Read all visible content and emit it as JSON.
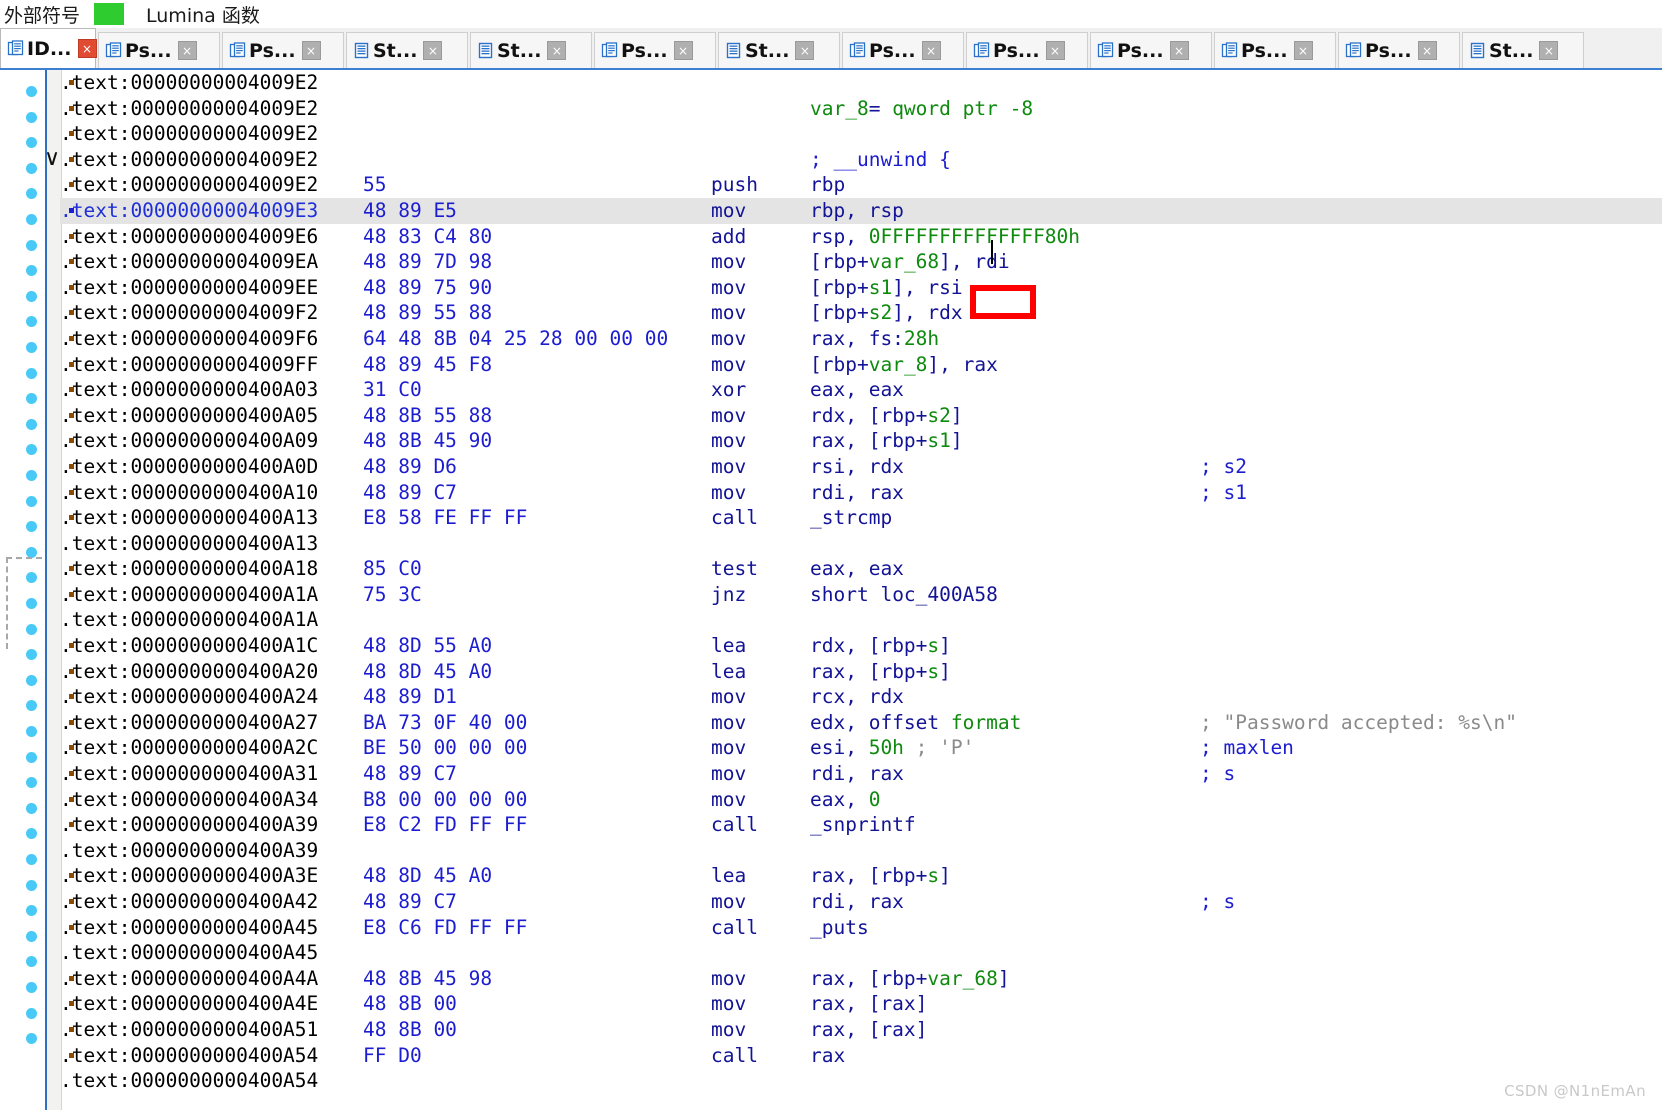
{
  "header": {
    "external_symbols_label": "外部符号",
    "swatch_color": "#2ecc2e",
    "lumina_label": "Lumina 函数"
  },
  "tabs": [
    {
      "label": "ID...",
      "icon": "document-icon",
      "active": true,
      "close": "×"
    },
    {
      "label": "Ps...",
      "icon": "pseudocode-icon",
      "active": false,
      "close": "×"
    },
    {
      "label": "Ps...",
      "icon": "pseudocode-icon",
      "active": false,
      "close": "×"
    },
    {
      "label": "St...",
      "icon": "structures-icon",
      "active": false,
      "close": "×"
    },
    {
      "label": "St...",
      "icon": "structures-icon",
      "active": false,
      "close": "×"
    },
    {
      "label": "Ps...",
      "icon": "pseudocode-icon",
      "active": false,
      "close": "×"
    },
    {
      "label": "St...",
      "icon": "structures-icon",
      "active": false,
      "close": "×"
    },
    {
      "label": "Ps...",
      "icon": "pseudocode-icon",
      "active": false,
      "close": "×"
    },
    {
      "label": "Ps...",
      "icon": "pseudocode-icon",
      "active": false,
      "close": "×"
    },
    {
      "label": "Ps...",
      "icon": "pseudocode-icon",
      "active": false,
      "close": "×"
    },
    {
      "label": "Ps...",
      "icon": "pseudocode-icon",
      "active": false,
      "close": "×"
    },
    {
      "label": "Ps...",
      "icon": "pseudocode-icon",
      "active": false,
      "close": "×"
    },
    {
      "label": "St...",
      "icon": "structures-icon",
      "active": false,
      "close": "×"
    }
  ],
  "colors": {
    "address": "#000000",
    "bytes": "#1d1dd0",
    "mnemonic": "#131396",
    "identifier": "#0e8a0e",
    "comment": "#1d1dd0",
    "string_comment": "#8a8a8a",
    "selection": "#e4e4e4",
    "annotation_box": "#ff0000",
    "gutter_dot": "#49c9f5"
  },
  "annotation": {
    "boxed_operand": "rdi",
    "box_color": "#ff0000"
  },
  "watermark": "CSDN @N1nEmAn",
  "disassembly": {
    "segment": ".text",
    "rows": [
      {
        "addr": ".text:00000000004009E2",
        "bytes": "",
        "mnem": "",
        "ops": [],
        "cmt": "",
        "sel": false,
        "marker": true,
        "chevron": false
      },
      {
        "addr": ".text:00000000004009E2",
        "bytes": "",
        "mnem": "",
        "ops": [
          {
            "t": "name",
            "v": "var_8"
          },
          {
            "t": "op",
            "v": "= "
          },
          {
            "t": "name",
            "v": "qword ptr -8"
          }
        ],
        "cmt": "",
        "sel": false,
        "marker": true,
        "chevron": false
      },
      {
        "addr": ".text:00000000004009E2",
        "bytes": "",
        "mnem": "",
        "ops": [],
        "cmt": "",
        "sel": false,
        "marker": true,
        "chevron": false
      },
      {
        "addr": ".text:00000000004009E2",
        "bytes": "",
        "mnem": "",
        "ops": [
          {
            "t": "cmt",
            "v": "; __unwind {"
          }
        ],
        "cmt": "",
        "sel": false,
        "marker": true,
        "chevron": false
      },
      {
        "addr": ".text:00000000004009E2",
        "bytes": "55",
        "mnem": "push",
        "ops": [
          {
            "t": "op",
            "v": "rbp"
          }
        ],
        "cmt": "",
        "sel": false,
        "marker": true,
        "chevron": true
      },
      {
        "addr": ".text:00000000004009E3",
        "bytes": "48 89 E5",
        "mnem": "mov",
        "ops": [
          {
            "t": "op",
            "v": "rbp, rsp"
          }
        ],
        "cmt": "",
        "sel": true,
        "marker": true,
        "chevron": false
      },
      {
        "addr": ".text:00000000004009E6",
        "bytes": "48 83 C4 80",
        "mnem": "add",
        "ops": [
          {
            "t": "op",
            "v": "rsp, "
          },
          {
            "t": "num",
            "v": "0FFFFFFFFFFFFFF80h"
          }
        ],
        "cmt": "",
        "sel": false,
        "marker": true,
        "chevron": false
      },
      {
        "addr": ".text:00000000004009EA",
        "bytes": "48 89 7D 98",
        "mnem": "mov",
        "ops": [
          {
            "t": "op",
            "v": "["
          },
          {
            "t": "op",
            "v": "rbp+"
          },
          {
            "t": "name",
            "v": "var_68"
          },
          {
            "t": "op",
            "v": "], rdi"
          }
        ],
        "cmt": "",
        "sel": false,
        "marker": true,
        "chevron": false
      },
      {
        "addr": ".text:00000000004009EE",
        "bytes": "48 89 75 90",
        "mnem": "mov",
        "ops": [
          {
            "t": "op",
            "v": "["
          },
          {
            "t": "op",
            "v": "rbp+"
          },
          {
            "t": "name",
            "v": "s1"
          },
          {
            "t": "op",
            "v": "], rsi"
          }
        ],
        "cmt": "",
        "sel": false,
        "marker": true,
        "chevron": false
      },
      {
        "addr": ".text:00000000004009F2",
        "bytes": "48 89 55 88",
        "mnem": "mov",
        "ops": [
          {
            "t": "op",
            "v": "["
          },
          {
            "t": "op",
            "v": "rbp+"
          },
          {
            "t": "name",
            "v": "s2"
          },
          {
            "t": "op",
            "v": "], rdx"
          }
        ],
        "cmt": "",
        "sel": false,
        "marker": true,
        "chevron": false
      },
      {
        "addr": ".text:00000000004009F6",
        "bytes": "64 48 8B 04 25 28 00 00 00",
        "mnem": "mov",
        "ops": [
          {
            "t": "op",
            "v": "rax, fs:"
          },
          {
            "t": "num",
            "v": "28h"
          }
        ],
        "cmt": "",
        "sel": false,
        "marker": true,
        "chevron": false
      },
      {
        "addr": ".text:00000000004009FF",
        "bytes": "48 89 45 F8",
        "mnem": "mov",
        "ops": [
          {
            "t": "op",
            "v": "["
          },
          {
            "t": "op",
            "v": "rbp+"
          },
          {
            "t": "name",
            "v": "var_8"
          },
          {
            "t": "op",
            "v": "], rax"
          }
        ],
        "cmt": "",
        "sel": false,
        "marker": true,
        "chevron": false
      },
      {
        "addr": ".text:0000000000400A03",
        "bytes": "31 C0",
        "mnem": "xor",
        "ops": [
          {
            "t": "op",
            "v": "eax, eax"
          }
        ],
        "cmt": "",
        "sel": false,
        "marker": true,
        "chevron": false
      },
      {
        "addr": ".text:0000000000400A05",
        "bytes": "48 8B 55 88",
        "mnem": "mov",
        "ops": [
          {
            "t": "op",
            "v": "rdx, ["
          },
          {
            "t": "op",
            "v": "rbp+"
          },
          {
            "t": "name",
            "v": "s2"
          },
          {
            "t": "op",
            "v": "]"
          }
        ],
        "cmt": "",
        "sel": false,
        "marker": true,
        "chevron": false
      },
      {
        "addr": ".text:0000000000400A09",
        "bytes": "48 8B 45 90",
        "mnem": "mov",
        "ops": [
          {
            "t": "op",
            "v": "rax, ["
          },
          {
            "t": "op",
            "v": "rbp+"
          },
          {
            "t": "name",
            "v": "s1"
          },
          {
            "t": "op",
            "v": "]"
          }
        ],
        "cmt": "",
        "sel": false,
        "marker": true,
        "chevron": false
      },
      {
        "addr": ".text:0000000000400A0D",
        "bytes": "48 89 D6",
        "mnem": "mov",
        "ops": [
          {
            "t": "op",
            "v": "rsi, rdx"
          }
        ],
        "cmt": "; s2",
        "sel": false,
        "marker": true,
        "chevron": false
      },
      {
        "addr": ".text:0000000000400A10",
        "bytes": "48 89 C7",
        "mnem": "mov",
        "ops": [
          {
            "t": "op",
            "v": "rdi, rax"
          }
        ],
        "cmt": "; s1",
        "sel": false,
        "marker": true,
        "chevron": false
      },
      {
        "addr": ".text:0000000000400A13",
        "bytes": "E8 58 FE FF FF",
        "mnem": "call",
        "ops": [
          {
            "t": "sub",
            "v": "_strcmp"
          }
        ],
        "cmt": "",
        "sel": false,
        "marker": true,
        "chevron": false
      },
      {
        "addr": ".text:0000000000400A13",
        "bytes": "",
        "mnem": "",
        "ops": [],
        "cmt": "",
        "sel": false,
        "marker": false,
        "chevron": false
      },
      {
        "addr": ".text:0000000000400A18",
        "bytes": "85 C0",
        "mnem": "test",
        "ops": [
          {
            "t": "op",
            "v": "eax, eax"
          }
        ],
        "cmt": "",
        "sel": false,
        "marker": true,
        "chevron": false
      },
      {
        "addr": ".text:0000000000400A1A",
        "bytes": "75 3C",
        "mnem": "jnz",
        "ops": [
          {
            "t": "op",
            "v": "short "
          },
          {
            "t": "sub",
            "v": "loc_400A58"
          }
        ],
        "cmt": "",
        "sel": false,
        "marker": true,
        "chevron": false
      },
      {
        "addr": ".text:0000000000400A1A",
        "bytes": "",
        "mnem": "",
        "ops": [],
        "cmt": "",
        "sel": false,
        "marker": false,
        "chevron": false
      },
      {
        "addr": ".text:0000000000400A1C",
        "bytes": "48 8D 55 A0",
        "mnem": "lea",
        "ops": [
          {
            "t": "op",
            "v": "rdx, ["
          },
          {
            "t": "op",
            "v": "rbp+"
          },
          {
            "t": "name",
            "v": "s"
          },
          {
            "t": "op",
            "v": "]"
          }
        ],
        "cmt": "",
        "sel": false,
        "marker": true,
        "chevron": false
      },
      {
        "addr": ".text:0000000000400A20",
        "bytes": "48 8D 45 A0",
        "mnem": "lea",
        "ops": [
          {
            "t": "op",
            "v": "rax, ["
          },
          {
            "t": "op",
            "v": "rbp+"
          },
          {
            "t": "name",
            "v": "s"
          },
          {
            "t": "op",
            "v": "]"
          }
        ],
        "cmt": "",
        "sel": false,
        "marker": true,
        "chevron": false
      },
      {
        "addr": ".text:0000000000400A24",
        "bytes": "48 89 D1",
        "mnem": "mov",
        "ops": [
          {
            "t": "op",
            "v": "rcx, rdx"
          }
        ],
        "cmt": "",
        "sel": false,
        "marker": true,
        "chevron": false
      },
      {
        "addr": ".text:0000000000400A27",
        "bytes": "BA 73 0F 40 00",
        "mnem": "mov",
        "ops": [
          {
            "t": "op",
            "v": "edx, offset "
          },
          {
            "t": "name",
            "v": "format"
          }
        ],
        "cmt": "; \"Password accepted: %s\\n\"",
        "cmtstr": true,
        "sel": false,
        "marker": true,
        "chevron": false
      },
      {
        "addr": ".text:0000000000400A2C",
        "bytes": "BE 50 00 00 00",
        "mnem": "mov",
        "ops": [
          {
            "t": "op",
            "v": "esi, "
          },
          {
            "t": "num",
            "v": "50h"
          },
          {
            "t": "gray",
            "v": " ; 'P'"
          }
        ],
        "cmt": "; maxlen",
        "sel": false,
        "marker": true,
        "chevron": false
      },
      {
        "addr": ".text:0000000000400A31",
        "bytes": "48 89 C7",
        "mnem": "mov",
        "ops": [
          {
            "t": "op",
            "v": "rdi, rax"
          }
        ],
        "cmt": "; s",
        "sel": false,
        "marker": true,
        "chevron": false
      },
      {
        "addr": ".text:0000000000400A34",
        "bytes": "B8 00 00 00 00",
        "mnem": "mov",
        "ops": [
          {
            "t": "op",
            "v": "eax, "
          },
          {
            "t": "num",
            "v": "0"
          }
        ],
        "cmt": "",
        "sel": false,
        "marker": true,
        "chevron": false
      },
      {
        "addr": ".text:0000000000400A39",
        "bytes": "E8 C2 FD FF FF",
        "mnem": "call",
        "ops": [
          {
            "t": "sub",
            "v": "_snprintf"
          }
        ],
        "cmt": "",
        "sel": false,
        "marker": true,
        "chevron": false
      },
      {
        "addr": ".text:0000000000400A39",
        "bytes": "",
        "mnem": "",
        "ops": [],
        "cmt": "",
        "sel": false,
        "marker": false,
        "chevron": false
      },
      {
        "addr": ".text:0000000000400A3E",
        "bytes": "48 8D 45 A0",
        "mnem": "lea",
        "ops": [
          {
            "t": "op",
            "v": "rax, ["
          },
          {
            "t": "op",
            "v": "rbp+"
          },
          {
            "t": "name",
            "v": "s"
          },
          {
            "t": "op",
            "v": "]"
          }
        ],
        "cmt": "",
        "sel": false,
        "marker": true,
        "chevron": false
      },
      {
        "addr": ".text:0000000000400A42",
        "bytes": "48 89 C7",
        "mnem": "mov",
        "ops": [
          {
            "t": "op",
            "v": "rdi, rax"
          }
        ],
        "cmt": "; s",
        "sel": false,
        "marker": true,
        "chevron": false
      },
      {
        "addr": ".text:0000000000400A45",
        "bytes": "E8 C6 FD FF FF",
        "mnem": "call",
        "ops": [
          {
            "t": "sub",
            "v": "_puts"
          }
        ],
        "cmt": "",
        "sel": false,
        "marker": true,
        "chevron": false
      },
      {
        "addr": ".text:0000000000400A45",
        "bytes": "",
        "mnem": "",
        "ops": [],
        "cmt": "",
        "sel": false,
        "marker": false,
        "chevron": false
      },
      {
        "addr": ".text:0000000000400A4A",
        "bytes": "48 8B 45 98",
        "mnem": "mov",
        "ops": [
          {
            "t": "op",
            "v": "rax, ["
          },
          {
            "t": "op",
            "v": "rbp+"
          },
          {
            "t": "name",
            "v": "var_68"
          },
          {
            "t": "op",
            "v": "]"
          }
        ],
        "cmt": "",
        "sel": false,
        "marker": true,
        "chevron": false
      },
      {
        "addr": ".text:0000000000400A4E",
        "bytes": "48 8B 00",
        "mnem": "mov",
        "ops": [
          {
            "t": "op",
            "v": "rax, [rax]"
          }
        ],
        "cmt": "",
        "sel": false,
        "marker": true,
        "chevron": false
      },
      {
        "addr": ".text:0000000000400A51",
        "bytes": "48 8B 00",
        "mnem": "mov",
        "ops": [
          {
            "t": "op",
            "v": "rax, [rax]"
          }
        ],
        "cmt": "",
        "sel": false,
        "marker": true,
        "chevron": false
      },
      {
        "addr": ".text:0000000000400A54",
        "bytes": "FF D0",
        "mnem": "call",
        "ops": [
          {
            "t": "op",
            "v": "rax"
          }
        ],
        "cmt": "",
        "sel": false,
        "marker": true,
        "chevron": false
      },
      {
        "addr": ".text:0000000000400A54",
        "bytes": "",
        "mnem": "",
        "ops": [],
        "cmt": "",
        "sel": false,
        "marker": false,
        "chevron": false
      }
    ]
  }
}
